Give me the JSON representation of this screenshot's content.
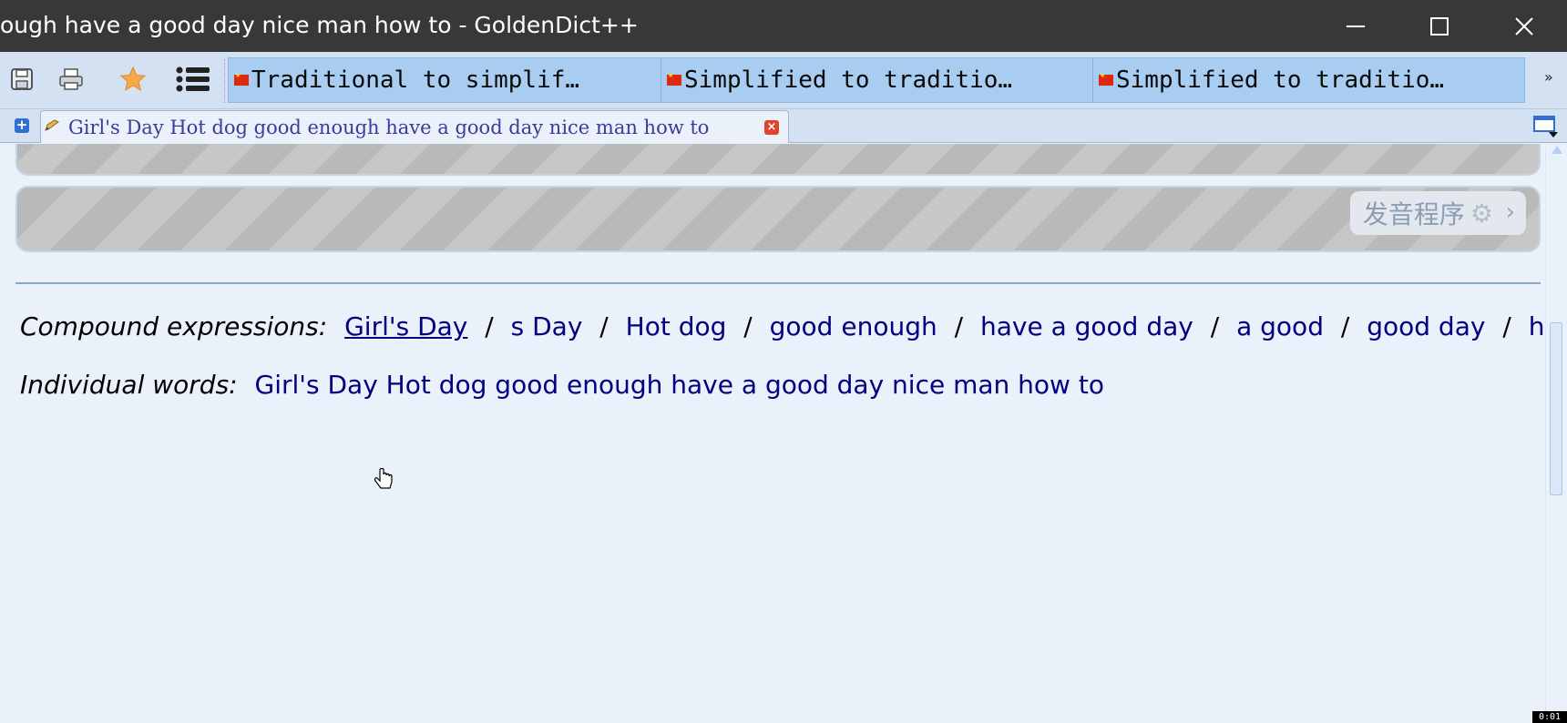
{
  "window": {
    "title": "ough have a good day nice man how to - GoldenDict++"
  },
  "toolbar": {
    "icons": [
      "save-icon",
      "print-icon",
      "favorites-star-icon",
      "list-icon"
    ],
    "dict_buttons": [
      {
        "label": "Traditional to simplif…"
      },
      {
        "label": "Simplified to traditio…"
      },
      {
        "label": "Simplified to traditio…"
      }
    ],
    "more": "»"
  },
  "tabs": {
    "active_label": "Girl's Day Hot dog good enough have a good day nice man how to"
  },
  "content": {
    "pronunciation_label": "发音程序",
    "compound": {
      "lead": "Compound expressions:",
      "items": [
        "Girl's Day",
        "s Day",
        "Hot dog",
        "good enough",
        "have a good day",
        "a good",
        "good day",
        "how to"
      ],
      "separator": "/"
    },
    "individual": {
      "lead": "Individual words:",
      "text": "Girl's Day Hot dog good enough have a good day nice man how to"
    }
  },
  "status": {
    "timer": "0:01"
  },
  "colors": {
    "link": "#000080",
    "titlebar": "#383838",
    "toolbar": "#d3e1f2",
    "content_bg": "#eaf1fa"
  }
}
